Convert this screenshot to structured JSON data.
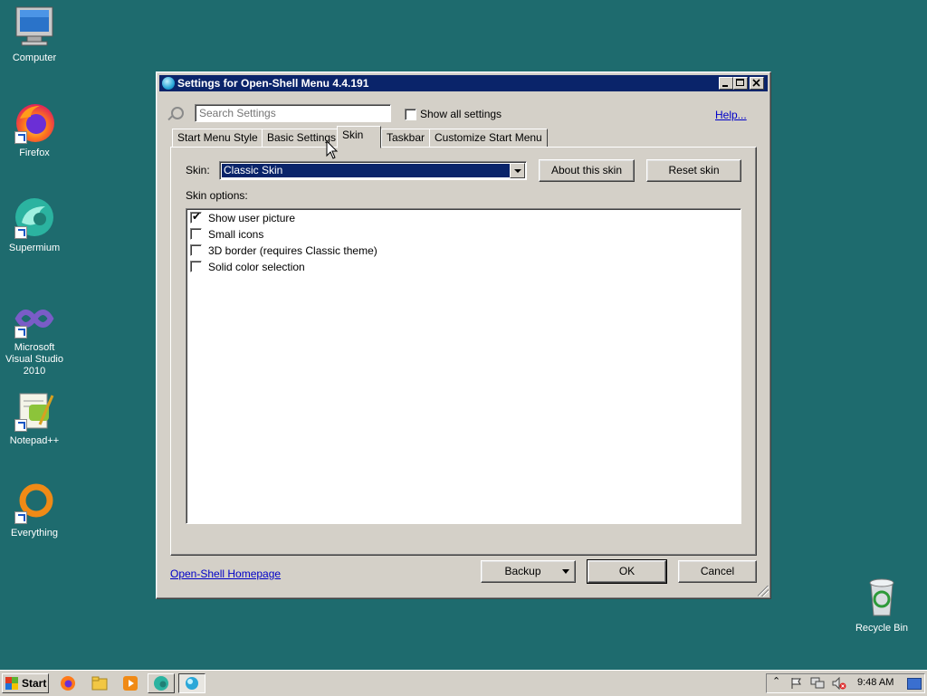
{
  "desktop": {
    "icons": [
      {
        "label": "Computer"
      },
      {
        "label": "Firefox"
      },
      {
        "label": "Supermium"
      },
      {
        "label": "Microsoft Visual Studio 2010"
      },
      {
        "label": "Notepad++"
      },
      {
        "label": "Everything"
      },
      {
        "label": "Recycle Bin"
      }
    ]
  },
  "window": {
    "title": "Settings for Open-Shell Menu 4.4.191",
    "search_placeholder": "Search Settings",
    "show_all_label": "Show all settings",
    "show_all_checked": false,
    "help_label": "Help...",
    "tabs": [
      {
        "label": "Start Menu Style",
        "active": false
      },
      {
        "label": "Basic Settings",
        "active": false
      },
      {
        "label": "Skin",
        "active": true
      },
      {
        "label": "Taskbar",
        "active": false
      },
      {
        "label": "Customize Start Menu",
        "active": false
      }
    ],
    "skin_label": "Skin:",
    "skin_value": "Classic Skin",
    "about_skin_label": "About this skin",
    "reset_skin_label": "Reset skin",
    "skin_options_label": "Skin options:",
    "options": [
      {
        "label": "Show user picture",
        "checked": true
      },
      {
        "label": "Small icons",
        "checked": false
      },
      {
        "label": "3D border (requires Classic theme)",
        "checked": false
      },
      {
        "label": "Solid color selection",
        "checked": false
      }
    ],
    "homepage_label": "Open-Shell Homepage",
    "backup_label": "Backup",
    "ok_label": "OK",
    "cancel_label": "Cancel"
  },
  "taskbar": {
    "start_label": "Start",
    "clock": "9:48 AM"
  },
  "colors": {
    "desktop": "#1e6b6e",
    "titlebar": "#0a246a",
    "face": "#d4d0c8",
    "selection": "#0a246a",
    "link": "#0000c8"
  }
}
